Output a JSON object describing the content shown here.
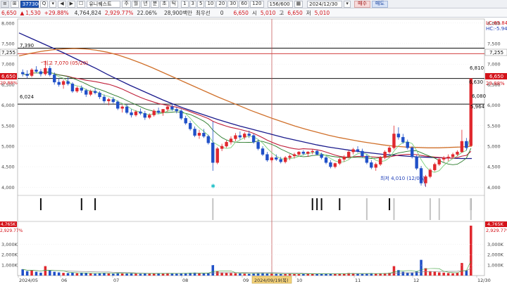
{
  "toolbar": {
    "code": "377300",
    "name": "유니퀘스트",
    "period_buttons": [
      "주",
      "월",
      "년",
      "분",
      "초",
      "틱"
    ],
    "interval_buttons": [
      "1",
      "3",
      "5",
      "10",
      "20",
      "30",
      "60",
      "120"
    ],
    "count": "156/600",
    "date": "2024/12/30",
    "buy_label": "매수",
    "sell_label": "매도",
    "menu_glyph": "≡",
    "prev_glyph": "◀",
    "next_glyph": "▶",
    "search_glyph": "Q",
    "list_glyph": "▾"
  },
  "quote": {
    "price": "6,650",
    "change": "1,530",
    "change_pct": "+29.88%",
    "volume": "4,764,824",
    "volume_pct": "2,929.77%",
    "turnover_pct": "22.06%",
    "amount": "28,900백만",
    "priority": "최우선",
    "zero": "0",
    "open_label": "시",
    "open": "5,010",
    "high_label": "고",
    "high": "6,650",
    "low_label": "저",
    "low": "5,010"
  },
  "chart_data": {
    "type": "candlestick",
    "x_labels": [
      "2024/05",
      "06",
      "07",
      "08",
      "09",
      "10",
      "11",
      "12",
      "12/30"
    ],
    "crosshair_date": "2024/09/19(목)",
    "y_ticks": [
      "8,000",
      "7,500",
      "7,000",
      "6,500",
      "6,000",
      "5,500",
      "5,000",
      "4,500",
      "4,000"
    ],
    "ylim": [
      3,
      800,
      8,
      100
    ],
    "hlines": [
      {
        "label": "7,390",
        "value": 7390
      },
      {
        "label": "7,255",
        "value": 7255
      },
      {
        "label": "6,650",
        "value": 6650
      },
      {
        "label": "6,024",
        "value": 6024
      }
    ],
    "annotations": {
      "high": "최고 7,070 (05/20)",
      "low": "최저 4,010 (12/09)"
    },
    "right_labels": {
      "lc": "LC:65.84",
      "hc": "HC:-5.94",
      "price_box": "6,650",
      "pct_1": "29.88%",
      "label_7255": "7,255",
      "label_6810": "6,810",
      "label_6630": "6,630",
      "label_6080": "6,080",
      "label_5964": "5,964"
    },
    "left_labels": {
      "price_box": "6,650",
      "pct": "29.88%",
      "label_7255": "7,255"
    },
    "volume_ticks": [
      "3,000K",
      "2,000K",
      "1,000K"
    ],
    "volume_right": {
      "value": "4,765K",
      "pct": "2,929.77%"
    },
    "volume_left": {
      "value": "4,765K",
      "pct": "2,929.77%"
    },
    "candles": [
      [
        6800,
        6870,
        6700,
        6760
      ],
      [
        6760,
        6850,
        6650,
        6720
      ],
      [
        6720,
        6900,
        6680,
        6860
      ],
      [
        6860,
        6950,
        6780,
        6820
      ],
      [
        6820,
        6880,
        6700,
        6760
      ],
      [
        6760,
        7070,
        6720,
        6900
      ],
      [
        6900,
        6960,
        6700,
        6740
      ],
      [
        6740,
        6800,
        6500,
        6560
      ],
      [
        6560,
        6650,
        6450,
        6500
      ],
      [
        6500,
        6620,
        6400,
        6580
      ],
      [
        6580,
        6680,
        6480,
        6520
      ],
      [
        6520,
        6560,
        6300,
        6340
      ],
      [
        6340,
        6460,
        6300,
        6420
      ],
      [
        6420,
        6480,
        6300,
        6360
      ],
      [
        6360,
        6400,
        6200,
        6260
      ],
      [
        6260,
        6380,
        6220,
        6340
      ],
      [
        6340,
        6420,
        6260,
        6300
      ],
      [
        6300,
        6340,
        6150,
        6200
      ],
      [
        6200,
        6260,
        6050,
        6100
      ],
      [
        6100,
        6180,
        6000,
        6140
      ],
      [
        6140,
        6200,
        6040,
        6080
      ],
      [
        6080,
        6120,
        5880,
        5920
      ],
      [
        5920,
        6000,
        5820,
        5960
      ],
      [
        5960,
        6020,
        5780,
        5820
      ],
      [
        5820,
        5900,
        5700,
        5760
      ],
      [
        5760,
        5880,
        5720,
        5840
      ],
      [
        5840,
        5920,
        5760,
        5800
      ],
      [
        5800,
        5860,
        5640,
        5700
      ],
      [
        5700,
        5800,
        5660,
        5760
      ],
      [
        5760,
        5900,
        5720,
        5860
      ],
      [
        5860,
        5940,
        5780,
        5820
      ],
      [
        5820,
        5880,
        5740,
        5900
      ],
      [
        5900,
        6000,
        5840,
        5960
      ],
      [
        5960,
        6020,
        5860,
        5900
      ],
      [
        5900,
        5940,
        5800,
        5860
      ],
      [
        5860,
        5900,
        5640,
        5680
      ],
      [
        5680,
        5740,
        5520,
        5560
      ],
      [
        5560,
        5620,
        5380,
        5420
      ],
      [
        5420,
        5480,
        5220,
        5260
      ],
      [
        5260,
        5400,
        5180,
        5320
      ],
      [
        5320,
        5420,
        5200,
        5240
      ],
      [
        5240,
        5280,
        5040,
        5080
      ],
      [
        5080,
        5600,
        4400,
        4600
      ],
      [
        4600,
        4980,
        4560,
        4940
      ],
      [
        4940,
        5060,
        4880,
        5000
      ],
      [
        5000,
        5140,
        4960,
        5100
      ],
      [
        5100,
        5240,
        5040,
        5180
      ],
      [
        5180,
        5320,
        5120,
        5260
      ],
      [
        5260,
        5360,
        5160,
        5220
      ],
      [
        5220,
        5340,
        5160,
        5300
      ],
      [
        5300,
        5380,
        5200,
        5260
      ],
      [
        5260,
        5300,
        5060,
        5100
      ],
      [
        5100,
        5160,
        4900,
        4940
      ],
      [
        4940,
        5000,
        4760,
        4800
      ],
      [
        4800,
        4860,
        4620,
        4660
      ],
      [
        4660,
        4760,
        4600,
        4720
      ],
      [
        4720,
        4800,
        4640,
        4680
      ],
      [
        4680,
        4740,
        4580,
        4620
      ],
      [
        4620,
        4760,
        4580,
        4720
      ],
      [
        4720,
        4800,
        4660,
        4760
      ],
      [
        4760,
        4840,
        4700,
        4800
      ],
      [
        4800,
        4880,
        4760,
        4860
      ],
      [
        4860,
        4900,
        4780,
        4820
      ],
      [
        4820,
        4880,
        4740,
        4860
      ],
      [
        4860,
        4920,
        4800,
        4880
      ],
      [
        4880,
        4920,
        4780,
        4800
      ],
      [
        4800,
        4840,
        4680,
        4720
      ],
      [
        4720,
        4760,
        4560,
        4600
      ],
      [
        4600,
        4660,
        4460,
        4500
      ],
      [
        4500,
        4600,
        4460,
        4580
      ],
      [
        4580,
        4720,
        4540,
        4680
      ],
      [
        4680,
        4780,
        4620,
        4740
      ],
      [
        4740,
        4900,
        4700,
        4860
      ],
      [
        4860,
        4960,
        4800,
        4920
      ],
      [
        4920,
        5000,
        4840,
        4880
      ],
      [
        4880,
        4940,
        4720,
        4760
      ],
      [
        4760,
        4800,
        4560,
        4600
      ],
      [
        4600,
        4660,
        4440,
        4480
      ],
      [
        4480,
        4600,
        4400,
        4560
      ],
      [
        4560,
        4760,
        4520,
        4720
      ],
      [
        4720,
        4900,
        4680,
        4860
      ],
      [
        4860,
        5000,
        4820,
        4960
      ],
      [
        4960,
        5500,
        4920,
        5300
      ],
      [
        5300,
        5460,
        5160,
        5220
      ],
      [
        5220,
        5300,
        5060,
        5100
      ],
      [
        5100,
        5160,
        4920,
        4960
      ],
      [
        4960,
        5000,
        4700,
        4740
      ],
      [
        4740,
        4780,
        4420,
        4460
      ],
      [
        4460,
        4520,
        4040,
        4100
      ],
      [
        4100,
        4300,
        4010,
        4260
      ],
      [
        4260,
        4460,
        4220,
        4420
      ],
      [
        4420,
        4600,
        4380,
        4560
      ],
      [
        4560,
        4720,
        4520,
        4680
      ],
      [
        4680,
        4760,
        4620,
        4720
      ],
      [
        4720,
        4800,
        4640,
        4740
      ],
      [
        4740,
        4840,
        4700,
        4800
      ],
      [
        4800,
        4900,
        4760,
        4860
      ],
      [
        4860,
        5400,
        4840,
        5120
      ],
      [
        5120,
        5200,
        4900,
        4960
      ],
      [
        5010,
        6650,
        5010,
        6650
      ]
    ],
    "volumes": [
      600,
      420,
      520,
      360,
      280,
      900,
      480,
      360,
      300,
      260,
      240,
      280,
      220,
      260,
      240,
      200,
      180,
      220,
      260,
      200,
      180,
      240,
      200,
      220,
      240,
      180,
      160,
      200,
      180,
      220,
      200,
      180,
      240,
      200,
      180,
      220,
      240,
      260,
      280,
      220,
      200,
      260,
      1000,
      400,
      300,
      260,
      240,
      220,
      200,
      180,
      160,
      200,
      220,
      240,
      200,
      180,
      160,
      140,
      160,
      180,
      160,
      140,
      160,
      180,
      160,
      140,
      160,
      180,
      200,
      160,
      180,
      200,
      240,
      220,
      180,
      160,
      200,
      220,
      180,
      200,
      220,
      260,
      900,
      520,
      360,
      280,
      300,
      420,
      1500,
      700,
      420,
      360,
      300,
      280,
      240,
      220,
      260,
      1200,
      500,
      4765
    ],
    "signal_bars_black": [
      4,
      13,
      16,
      64,
      65,
      66,
      70,
      81,
      100
    ],
    "signal_bars_gray": [
      42,
      76,
      82,
      90,
      92,
      99
    ]
  }
}
